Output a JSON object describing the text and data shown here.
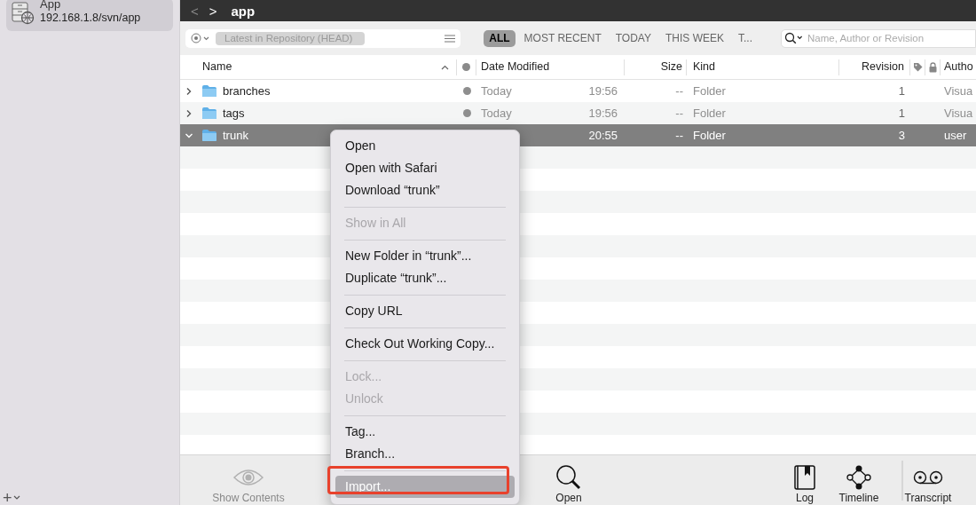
{
  "sidebar": {
    "items": [
      {
        "title": "App",
        "subtitle": "192.168.1.8/svn/app",
        "selected": true
      }
    ],
    "add_button": "+"
  },
  "toolbar": {
    "back": "<",
    "forward": ">",
    "title": "app"
  },
  "filter_bar": {
    "revision_field": "Latest in Repository (HEAD)",
    "tabs": [
      {
        "label": "ALL",
        "selected": true
      },
      {
        "label": "MOST RECENT",
        "selected": false
      },
      {
        "label": "TODAY",
        "selected": false
      },
      {
        "label": "THIS WEEK",
        "selected": false
      },
      {
        "label": "T...",
        "selected": false
      }
    ],
    "search": {
      "placeholder": "Name, Author or Revision"
    }
  },
  "table": {
    "columns": [
      "Name",
      "Date Modified",
      "Size",
      "Kind",
      "Revision",
      "Autho"
    ],
    "rows": [
      {
        "name": "branches",
        "expanded": false,
        "selected": false,
        "date": "Today",
        "time": "19:56",
        "size": "--",
        "kind": "Folder",
        "revision": "1",
        "author": "Visua"
      },
      {
        "name": "tags",
        "expanded": false,
        "selected": false,
        "date": "Today",
        "time": "19:56",
        "size": "--",
        "kind": "Folder",
        "revision": "1",
        "author": "Visua"
      },
      {
        "name": "trunk",
        "expanded": true,
        "selected": true,
        "time": "20:55",
        "size": "--",
        "kind": "Folder",
        "revision": "3",
        "author": "user"
      }
    ]
  },
  "context_menu": {
    "groups": [
      [
        {
          "label": "Open",
          "disabled": false,
          "selected": false
        },
        {
          "label": "Open with Safari",
          "disabled": false,
          "selected": false
        },
        {
          "label": "Download “trunk”",
          "disabled": false,
          "selected": false
        }
      ],
      [
        {
          "label": "Show in All",
          "disabled": true,
          "selected": false
        }
      ],
      [
        {
          "label": "New Folder in “trunk”...",
          "disabled": false,
          "selected": false
        },
        {
          "label": "Duplicate “trunk”...",
          "disabled": false,
          "selected": false
        }
      ],
      [
        {
          "label": "Copy URL",
          "disabled": false,
          "selected": false
        }
      ],
      [
        {
          "label": "Check Out Working Copy...",
          "disabled": false,
          "selected": false
        }
      ],
      [
        {
          "label": "Lock...",
          "disabled": true,
          "selected": false
        },
        {
          "label": "Unlock",
          "disabled": true,
          "selected": false
        }
      ],
      [
        {
          "label": "Tag...",
          "disabled": false,
          "selected": false
        },
        {
          "label": "Branch...",
          "disabled": false,
          "selected": false
        }
      ],
      [
        {
          "label": "Import...",
          "disabled": false,
          "selected": true,
          "annotated": true
        }
      ]
    ]
  },
  "bottom_toolbar": [
    {
      "kind": "eye",
      "label": "Show Contents",
      "disabled": true
    },
    {
      "kind": "search",
      "label": "Open",
      "disabled": false
    },
    {
      "kind": "book",
      "label": "Log",
      "disabled": false
    },
    {
      "kind": "timeline",
      "label": "Timeline",
      "disabled": false
    },
    {
      "kind": "tape",
      "label": "Transcript",
      "disabled": false
    }
  ]
}
